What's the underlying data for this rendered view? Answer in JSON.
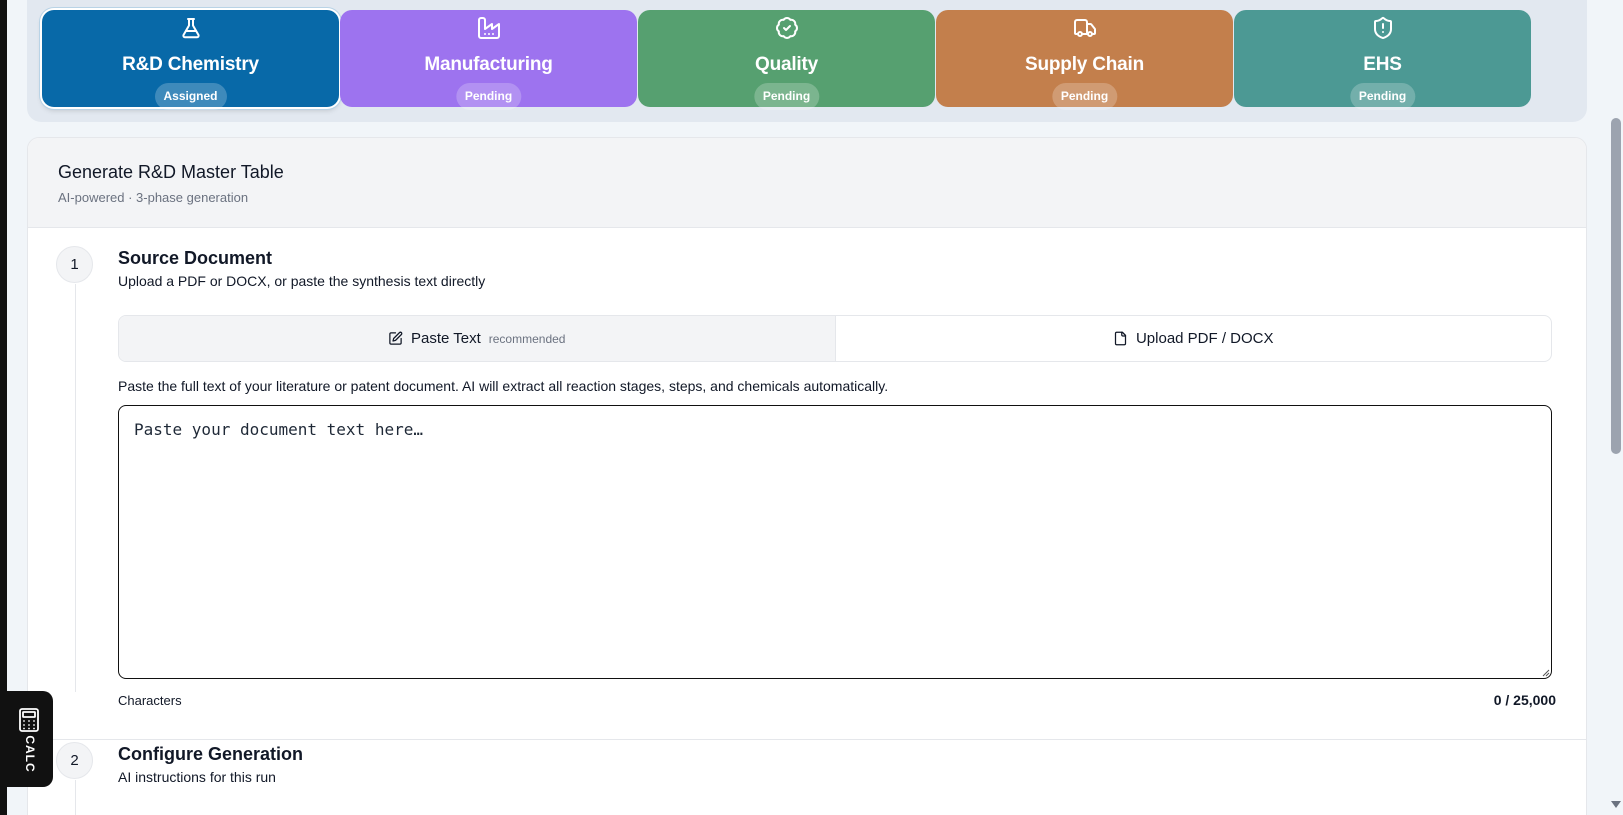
{
  "departments": [
    {
      "name": "R&D Chemistry",
      "status": "Assigned",
      "icon": "flask-icon",
      "color": "#0869a8"
    },
    {
      "name": "Manufacturing",
      "status": "Pending",
      "icon": "factory-icon",
      "color": "#9d73ef"
    },
    {
      "name": "Quality",
      "status": "Pending",
      "icon": "badge-check-icon",
      "color": "#56a070"
    },
    {
      "name": "Supply Chain",
      "status": "Pending",
      "icon": "truck-icon",
      "color": "#c37f4c"
    },
    {
      "name": "EHS",
      "status": "Pending",
      "icon": "shield-alert-icon",
      "color": "#4c9994"
    }
  ],
  "panel": {
    "title": "Generate R&D Master Table",
    "subtitle": "AI-powered · 3-phase generation"
  },
  "step1": {
    "number": "1",
    "title": "Source Document",
    "description": "Upload a PDF or DOCX, or paste the synthesis text directly",
    "tabs": {
      "paste_label": "Paste Text",
      "paste_note": "recommended",
      "upload_label": "Upload PDF / DOCX"
    },
    "help_text": "Paste the full text of your literature or patent document. AI will extract all reaction stages, steps, and chemicals automatically.",
    "textarea": {
      "value": "",
      "placeholder": "Paste your document text here…"
    },
    "characters_label": "Characters",
    "characters_count": "0 / 25,000"
  },
  "step2": {
    "number": "2",
    "title": "Configure Generation",
    "description": "AI instructions for this run"
  },
  "calc_widget": {
    "label": "CALC",
    "icon": "calculator-icon"
  }
}
